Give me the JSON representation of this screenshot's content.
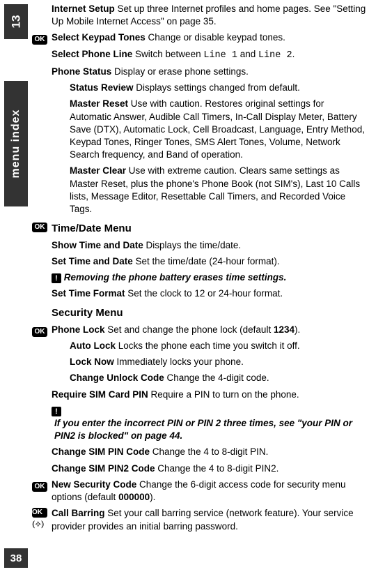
{
  "sidebar": {
    "chapter_num": "13",
    "tab_label": "menu index",
    "page_num": "38"
  },
  "icons": {
    "ok_label": "OK",
    "warn_label": "!",
    "antenna_glyph": "⦅⟡⦆"
  },
  "s1": {
    "internet_setup_t": "Internet Setup",
    "internet_setup_d": "  Set up three Internet profiles and home pages. See \"Setting Up Mobile Internet Access\" on page 35.",
    "keypad_t": "Select Keypad Tones",
    "keypad_d": "  Change or disable keypad tones.",
    "line_t": "Select Phone Line",
    "line_d1": "  Switch between ",
    "line_mono1": "Line 1",
    "line_d2": " and ",
    "line_mono2": "Line 2",
    "line_d3": ".",
    "status_t": "Phone Status",
    "status_d": "  Display or erase phone settings.",
    "review_t": "Status Review",
    "review_d": "  Displays settings changed from default.",
    "mreset_t": "Master Reset",
    "mreset_d": "  Use with caution. Restores original settings for Automatic Answer, Audible Call Timers, In-Call Display Meter, Battery Save (DTX), Automatic Lock, Cell Broadcast, Language, Entry Method, Keypad Tones, Ringer Tones, SMS Alert Tones, Volume, Network Search frequency, and Band of operation.",
    "mclear_t": "Master Clear",
    "mclear_d": "  Use with extreme caution. Clears same settings as Master Reset, plus the phone's Phone Book (not SIM's), Last 10 Calls lists, Message Editor, Resettable Call Timers, and Recorded Voice Tags."
  },
  "s2": {
    "head": "Time/Date Menu",
    "show_t": "Show Time and Date",
    "show_d": "  Displays the time/date.",
    "set_t": "Set Time and Date",
    "set_d": "  Set the time/date (24-hour format).",
    "warn_line": " Removing the phone battery erases time settings.",
    "fmt_t": "Set Time Format",
    "fmt_d": "  Set the clock to 12 or 24-hour format."
  },
  "s3": {
    "head": "Security Menu",
    "lock_t": "Phone Lock",
    "lock_d1": "  Set and change the phone lock (default ",
    "lock_code": "1234",
    "lock_d2": ").",
    "auto_t": "Auto Lock",
    "auto_d": "  Locks the phone each time you switch it off.",
    "now_t": "Lock Now",
    "now_d": "  Immediately locks your phone.",
    "chg_t": "Change Unlock Code",
    "chg_d": "  Change the 4-digit code.",
    "reqpin_t": "Require SIM Card PIN",
    "reqpin_d": "  Require a PIN to turn on the phone.",
    "warn1": " If you enter the incorrect PIN or PIN 2 three times, see \"your PIN or PIN2 is blocked\" on page 44.",
    "simpin_t": "Change SIM PIN Code",
    "simpin_d": "  Change the 4 to 8-digit PIN.",
    "simpin2_t": "Change SIM PIN2 Code",
    "simpin2_d": "  Change the 4 to 8-digit PIN2.",
    "newcode_t": "New Security Code",
    "newcode_d1": "  Change the 6-digit access code for security menu options (default ",
    "newcode_code": "000000",
    "newcode_d2": ").",
    "barring_t": "Call Barring",
    "barring_d": "  Set your call barring service (network feature). Your service provider provides an initial barring password."
  }
}
